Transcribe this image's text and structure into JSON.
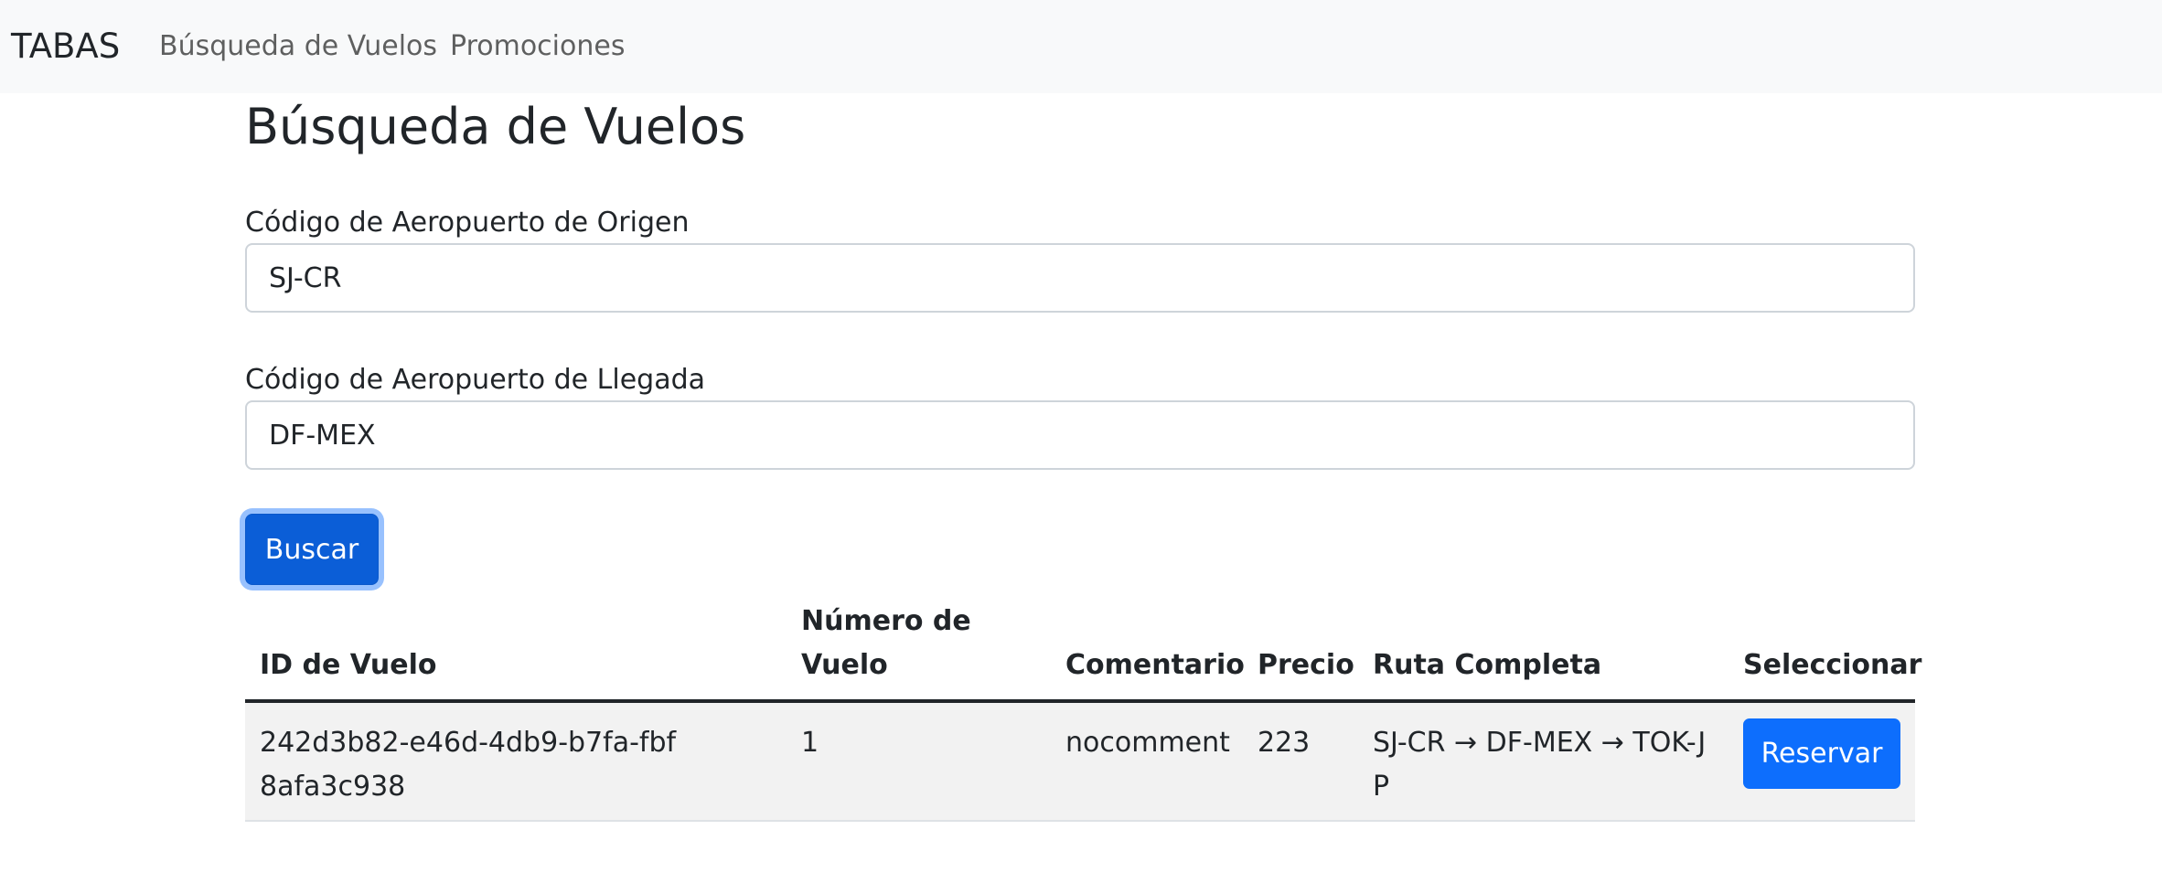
{
  "navbar": {
    "brand": "TABAS",
    "links": [
      "Búsqueda de Vuelos",
      "Promociones"
    ]
  },
  "page": {
    "title": "Búsqueda de Vuelos"
  },
  "form": {
    "origin_label": "Código de Aeropuerto de Origen",
    "origin_value": "SJ-CR",
    "arrival_label": "Código de Aeropuerto de Llegada",
    "arrival_value": "DF-MEX",
    "search_button": "Buscar"
  },
  "table": {
    "headers": [
      "ID de Vuelo",
      "Número de Vuelo",
      "Comentario",
      "Precio",
      "Ruta Completa",
      "Seleccionar"
    ],
    "rows": [
      {
        "id": "242d3b82-e46d-4db9-b7fa-fbf8afa3c938",
        "number": "1",
        "comment": "nocomment",
        "price": "223",
        "route": "SJ-CR → DF-MEX → TOK-JP",
        "action": "Reservar"
      }
    ]
  },
  "colors": {
    "primary": "#0d6efd",
    "navbar_bg": "#f8f9fa",
    "row_stripe": "#f2f2f2"
  }
}
